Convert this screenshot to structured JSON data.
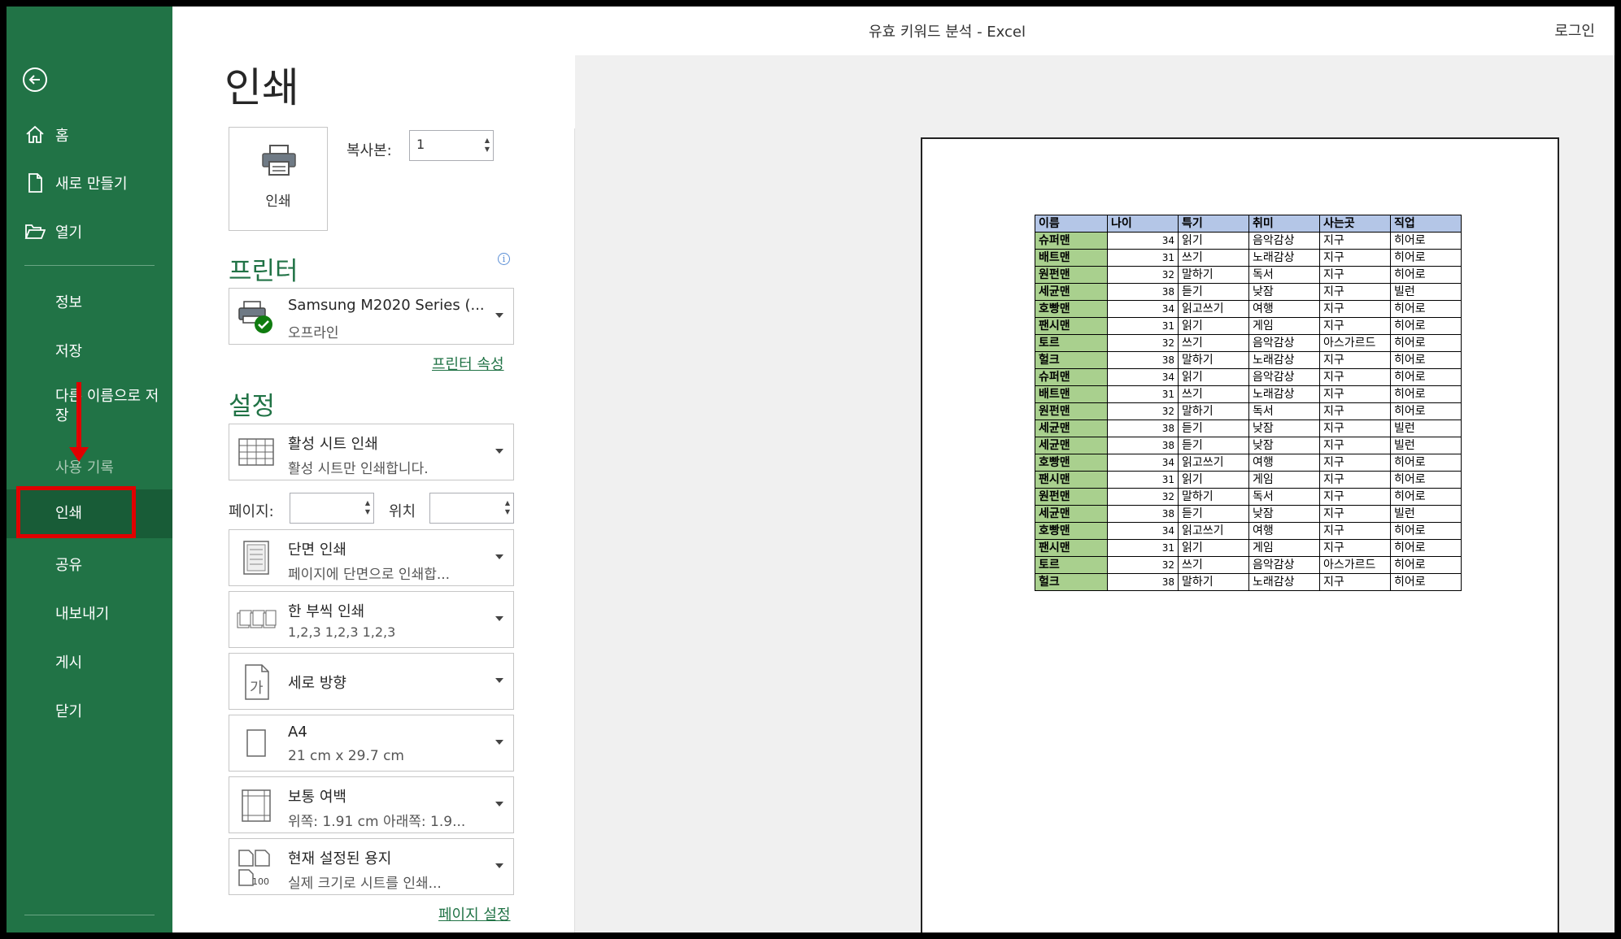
{
  "window": {
    "title": "유효 키워드 분석  -  Excel",
    "login": "로그인"
  },
  "sidebar": {
    "items": [
      {
        "label": "홈"
      },
      {
        "label": "새로 만들기"
      },
      {
        "label": "열기"
      },
      {
        "label": "정보"
      },
      {
        "label": "저장"
      },
      {
        "label": "다른 이름으로 저장"
      },
      {
        "label": "사용 기록"
      },
      {
        "label": "인쇄"
      },
      {
        "label": "공유"
      },
      {
        "label": "내보내기"
      },
      {
        "label": "게시"
      },
      {
        "label": "닫기"
      }
    ]
  },
  "main": {
    "title": "인쇄",
    "print_button": "인쇄",
    "copies_label": "복사본:",
    "copies_value": "1",
    "printer_heading": "프린터",
    "printer": {
      "name": "Samsung M2020 Series (...",
      "status": "오프라인"
    },
    "printer_props_link": "프린터 속성",
    "settings_heading": "설정",
    "settings": [
      {
        "line1": "활성 시트 인쇄",
        "line2": "활성 시트만 인쇄합니다."
      },
      {
        "line1": "단면 인쇄",
        "line2": "페이지에 단면으로 인쇄합..."
      },
      {
        "line1": "한 부씩 인쇄",
        "line2": "1,2,3     1,2,3     1,2,3"
      },
      {
        "line1": "세로 방향",
        "line2": ""
      },
      {
        "line1": "A4",
        "line2": "21 cm x 29.7 cm"
      },
      {
        "line1": "보통 여백",
        "line2": "위쪽: 1.91 cm 아래쪽: 1.9..."
      },
      {
        "line1": "현재 설정된 용지",
        "line2": "실제 크기로 시트를 인쇄..."
      }
    ],
    "pages_label": "페이지:",
    "position_label": "위치",
    "page_setup_link": "페이지 설정"
  },
  "preview": {
    "headers": [
      "이름",
      "나이",
      "특기",
      "취미",
      "사는곳",
      "직업"
    ],
    "rows": [
      [
        "슈퍼맨",
        "34",
        "읽기",
        "음악감상",
        "지구",
        "히어로"
      ],
      [
        "배트맨",
        "31",
        "쓰기",
        "노래감상",
        "지구",
        "히어로"
      ],
      [
        "원펀맨",
        "32",
        "말하기",
        "독서",
        "지구",
        "히어로"
      ],
      [
        "세균맨",
        "38",
        "듣기",
        "낮잠",
        "지구",
        "빌런"
      ],
      [
        "호빵맨",
        "34",
        "읽고쓰기",
        "여행",
        "지구",
        "히어로"
      ],
      [
        "팬시맨",
        "31",
        "읽기",
        "게임",
        "지구",
        "히어로"
      ],
      [
        "토르",
        "32",
        "쓰기",
        "음악감상",
        "아스가르드",
        "히어로"
      ],
      [
        "헐크",
        "38",
        "말하기",
        "노래감상",
        "지구",
        "히어로"
      ],
      [
        "슈퍼맨",
        "34",
        "읽기",
        "음악감상",
        "지구",
        "히어로"
      ],
      [
        "배트맨",
        "31",
        "쓰기",
        "노래감상",
        "지구",
        "히어로"
      ],
      [
        "원펀맨",
        "32",
        "말하기",
        "독서",
        "지구",
        "히어로"
      ],
      [
        "세균맨",
        "38",
        "듣기",
        "낮잠",
        "지구",
        "빌런"
      ],
      [
        "세균맨",
        "38",
        "듣기",
        "낮잠",
        "지구",
        "빌런"
      ],
      [
        "호빵맨",
        "34",
        "읽고쓰기",
        "여행",
        "지구",
        "히어로"
      ],
      [
        "팬시맨",
        "31",
        "읽기",
        "게임",
        "지구",
        "히어로"
      ],
      [
        "원펀맨",
        "32",
        "말하기",
        "독서",
        "지구",
        "히어로"
      ],
      [
        "세균맨",
        "38",
        "듣기",
        "낮잠",
        "지구",
        "빌런"
      ],
      [
        "호빵맨",
        "34",
        "읽고쓰기",
        "여행",
        "지구",
        "히어로"
      ],
      [
        "팬시맨",
        "31",
        "읽기",
        "게임",
        "지구",
        "히어로"
      ],
      [
        "토르",
        "32",
        "쓰기",
        "음악감상",
        "아스가르드",
        "히어로"
      ],
      [
        "헐크",
        "38",
        "말하기",
        "노래감상",
        "지구",
        "히어로"
      ]
    ]
  },
  "colors": {
    "sidebar_bg": "#217346",
    "sidebar_active": "#185c37",
    "accent": "#217346",
    "highlight_red": "#e00000",
    "header_fill": "#b4c6e7",
    "name_fill": "#a9d08e"
  }
}
